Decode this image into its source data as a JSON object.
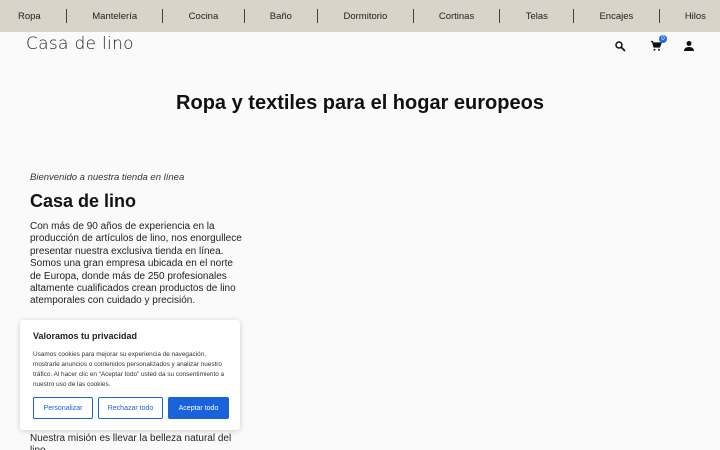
{
  "nav": {
    "items": [
      "Ropa",
      "Mantelería",
      "Cocina",
      "Baño",
      "Dormitorio",
      "Cortinas",
      "Telas",
      "Encajes",
      "Hilos"
    ]
  },
  "header": {
    "logo": "Casa de lino",
    "cart_count": "0",
    "icons": [
      "search-icon",
      "cart-icon",
      "user-icon"
    ]
  },
  "hero": {
    "title": "Ropa y textiles para el hogar europeos"
  },
  "about": {
    "welcome": "Bienvenido a nuestra tienda en línea",
    "title": "Casa de lino",
    "intro": "Con más de 90 años de experiencia en la producción de artículos de lino, nos enorgullece presentar nuestra exclusiva tienda en línea. Somos una gran empresa ubicada en el norte de Europa, donde más de 250 profesionales altamente cualificados crean productos de lino atemporales con cuidado y precisión.",
    "mission": "Nuestra misión es llevar la belleza natural del lino"
  },
  "cookie": {
    "title": "Valoramos tu privacidad",
    "body": "Usamos cookies para mejorar su experiencia de navegación, mostrarle anuncios o contenidos personalizados y analizar nuestro tráfico. Al hacer clic en “Aceptar todo” usted da su consentimiento a nuestro uso de las cookies.",
    "customize_label": "Personalizar",
    "reject_label": "Rechazar todo",
    "accept_label": "Aceptar todo"
  },
  "colors": {
    "nav_bg": "#d9d3c9",
    "accent": "#1863dc"
  }
}
